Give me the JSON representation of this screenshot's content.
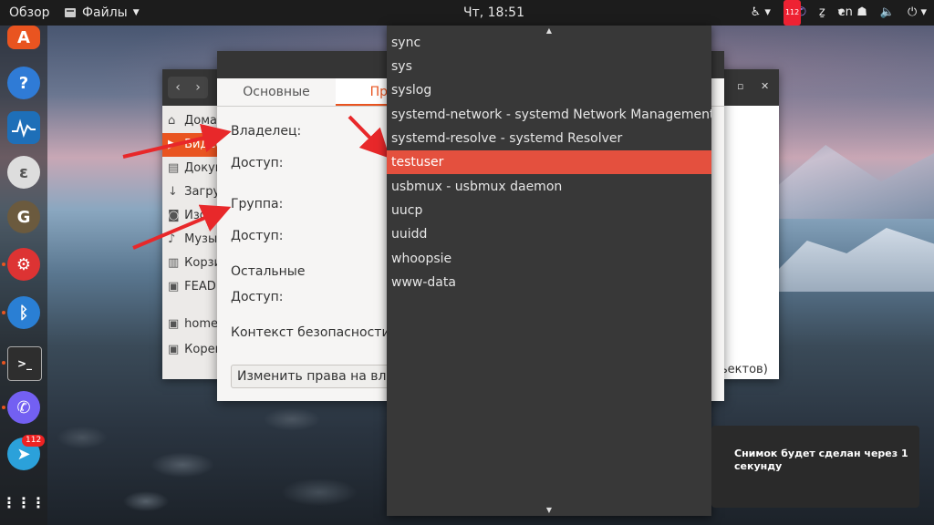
{
  "topbar": {
    "overview": "Обзор",
    "app_menu": "Файлы",
    "clock": "Чт, 18:51",
    "lang": "en",
    "tray_badge": "112"
  },
  "dock": {
    "telegram_badge": "112"
  },
  "file_manager": {
    "sidebar": [
      {
        "label": "Домашняя папка",
        "icon": "home-icon"
      },
      {
        "label": "Видео",
        "icon": "video-icon"
      },
      {
        "label": "Документы",
        "icon": "document-icon"
      },
      {
        "label": "Загрузки",
        "icon": "download-icon"
      },
      {
        "label": "Изображения",
        "icon": "camera-icon"
      },
      {
        "label": "Музыка",
        "icon": "music-icon"
      },
      {
        "label": "Корзина",
        "icon": "trash-icon"
      },
      {
        "label": "FEADRIVE",
        "icon": "drive-icon"
      },
      {
        "label": "home",
        "icon": "drive-icon"
      },
      {
        "label": "Корень",
        "icon": "drive-icon"
      }
    ],
    "status": "ьектов)"
  },
  "dialog": {
    "tabs": [
      "Основные",
      "Права"
    ],
    "owner_label": "Владелец:",
    "owner_access": "Доступ:",
    "group_label": "Группа:",
    "group_access": "Доступ:",
    "others_label": "Остальные",
    "others_access": "Доступ:",
    "security_context": "Контекст безопасности:",
    "change_perms_button": "Изменить права на вложенные файлы…"
  },
  "dropdown": {
    "items": [
      "sync",
      "sys",
      "syslog",
      "systemd-network - systemd Network Management",
      "systemd-resolve - systemd Resolver",
      "testuser",
      "usbmux - usbmux daemon",
      "uucp",
      "uuidd",
      "whoopsie",
      "www-data"
    ],
    "selected": "testuser"
  },
  "notification": {
    "text": "Снимок будет сделан через 1 секунду"
  },
  "colors": {
    "accent": "#e95420",
    "selection": "#e4503e",
    "arrow": "#e8282a"
  }
}
